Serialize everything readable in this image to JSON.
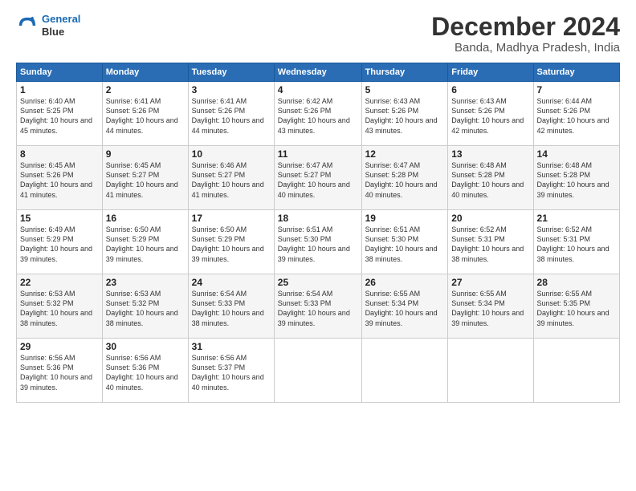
{
  "logo": {
    "line1": "General",
    "line2": "Blue"
  },
  "title": "December 2024",
  "subtitle": "Banda, Madhya Pradesh, India",
  "days_of_week": [
    "Sunday",
    "Monday",
    "Tuesday",
    "Wednesday",
    "Thursday",
    "Friday",
    "Saturday"
  ],
  "weeks": [
    [
      {
        "day": 1,
        "sunrise": "6:40 AM",
        "sunset": "5:25 PM",
        "daylight": "10 hours and 45 minutes."
      },
      {
        "day": 2,
        "sunrise": "6:41 AM",
        "sunset": "5:26 PM",
        "daylight": "10 hours and 44 minutes."
      },
      {
        "day": 3,
        "sunrise": "6:41 AM",
        "sunset": "5:26 PM",
        "daylight": "10 hours and 44 minutes."
      },
      {
        "day": 4,
        "sunrise": "6:42 AM",
        "sunset": "5:26 PM",
        "daylight": "10 hours and 43 minutes."
      },
      {
        "day": 5,
        "sunrise": "6:43 AM",
        "sunset": "5:26 PM",
        "daylight": "10 hours and 43 minutes."
      },
      {
        "day": 6,
        "sunrise": "6:43 AM",
        "sunset": "5:26 PM",
        "daylight": "10 hours and 42 minutes."
      },
      {
        "day": 7,
        "sunrise": "6:44 AM",
        "sunset": "5:26 PM",
        "daylight": "10 hours and 42 minutes."
      }
    ],
    [
      {
        "day": 8,
        "sunrise": "6:45 AM",
        "sunset": "5:26 PM",
        "daylight": "10 hours and 41 minutes."
      },
      {
        "day": 9,
        "sunrise": "6:45 AM",
        "sunset": "5:27 PM",
        "daylight": "10 hours and 41 minutes."
      },
      {
        "day": 10,
        "sunrise": "6:46 AM",
        "sunset": "5:27 PM",
        "daylight": "10 hours and 41 minutes."
      },
      {
        "day": 11,
        "sunrise": "6:47 AM",
        "sunset": "5:27 PM",
        "daylight": "10 hours and 40 minutes."
      },
      {
        "day": 12,
        "sunrise": "6:47 AM",
        "sunset": "5:28 PM",
        "daylight": "10 hours and 40 minutes."
      },
      {
        "day": 13,
        "sunrise": "6:48 AM",
        "sunset": "5:28 PM",
        "daylight": "10 hours and 40 minutes."
      },
      {
        "day": 14,
        "sunrise": "6:48 AM",
        "sunset": "5:28 PM",
        "daylight": "10 hours and 39 minutes."
      }
    ],
    [
      {
        "day": 15,
        "sunrise": "6:49 AM",
        "sunset": "5:29 PM",
        "daylight": "10 hours and 39 minutes."
      },
      {
        "day": 16,
        "sunrise": "6:50 AM",
        "sunset": "5:29 PM",
        "daylight": "10 hours and 39 minutes."
      },
      {
        "day": 17,
        "sunrise": "6:50 AM",
        "sunset": "5:29 PM",
        "daylight": "10 hours and 39 minutes."
      },
      {
        "day": 18,
        "sunrise": "6:51 AM",
        "sunset": "5:30 PM",
        "daylight": "10 hours and 39 minutes."
      },
      {
        "day": 19,
        "sunrise": "6:51 AM",
        "sunset": "5:30 PM",
        "daylight": "10 hours and 38 minutes."
      },
      {
        "day": 20,
        "sunrise": "6:52 AM",
        "sunset": "5:31 PM",
        "daylight": "10 hours and 38 minutes."
      },
      {
        "day": 21,
        "sunrise": "6:52 AM",
        "sunset": "5:31 PM",
        "daylight": "10 hours and 38 minutes."
      }
    ],
    [
      {
        "day": 22,
        "sunrise": "6:53 AM",
        "sunset": "5:32 PM",
        "daylight": "10 hours and 38 minutes."
      },
      {
        "day": 23,
        "sunrise": "6:53 AM",
        "sunset": "5:32 PM",
        "daylight": "10 hours and 38 minutes."
      },
      {
        "day": 24,
        "sunrise": "6:54 AM",
        "sunset": "5:33 PM",
        "daylight": "10 hours and 38 minutes."
      },
      {
        "day": 25,
        "sunrise": "6:54 AM",
        "sunset": "5:33 PM",
        "daylight": "10 hours and 39 minutes."
      },
      {
        "day": 26,
        "sunrise": "6:55 AM",
        "sunset": "5:34 PM",
        "daylight": "10 hours and 39 minutes."
      },
      {
        "day": 27,
        "sunrise": "6:55 AM",
        "sunset": "5:34 PM",
        "daylight": "10 hours and 39 minutes."
      },
      {
        "day": 28,
        "sunrise": "6:55 AM",
        "sunset": "5:35 PM",
        "daylight": "10 hours and 39 minutes."
      }
    ],
    [
      {
        "day": 29,
        "sunrise": "6:56 AM",
        "sunset": "5:36 PM",
        "daylight": "10 hours and 39 minutes."
      },
      {
        "day": 30,
        "sunrise": "6:56 AM",
        "sunset": "5:36 PM",
        "daylight": "10 hours and 40 minutes."
      },
      {
        "day": 31,
        "sunrise": "6:56 AM",
        "sunset": "5:37 PM",
        "daylight": "10 hours and 40 minutes."
      },
      null,
      null,
      null,
      null
    ]
  ]
}
